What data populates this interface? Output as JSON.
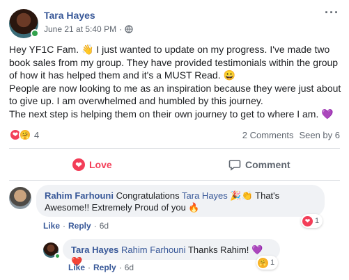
{
  "post": {
    "author": "Tara Hayes",
    "timestamp": "June 21 at 5:40 PM",
    "more_label": "···",
    "body": [
      "Hey YF1C Fam. 👋 I just wanted to update on my progress. I've made two book sales from my group. They have provided testimonials within the group of how it has helped them and it's a MUST Read. 😀",
      "People are now looking to me as an inspiration because they were just about to give up. I am overwhelmed and humbled by this journey.",
      "The next step is helping them on their own journey to get to where I am. 💜"
    ],
    "reaction_count": "4",
    "comments_count": "2 Comments",
    "seen_by": "Seen by 6"
  },
  "actions": {
    "love_label": "Love",
    "comment_label": "Comment"
  },
  "comments": [
    {
      "author": "Rahim Farhouni",
      "text_part1": "Congratulations",
      "mention": "Tara Hayes",
      "text_part2": "🎉👏 That's Awesome!! Extremely Proud of you 🔥",
      "like_label": "Like",
      "reply_label": "Reply",
      "age": "6d",
      "reaction_count": "1"
    },
    {
      "author": "Tara Hayes",
      "mention": "Rahim Farhouni",
      "text": "Thanks Rahim! 💜❤️",
      "like_label": "Like",
      "reply_label": "Reply",
      "age": "6d",
      "reaction_count": "1"
    }
  ],
  "separator": "·",
  "colors": {
    "link_blue": "#385898",
    "love_red": "#f33e58",
    "online_green": "#31a24c",
    "bubble_gray": "#f0f2f5"
  }
}
